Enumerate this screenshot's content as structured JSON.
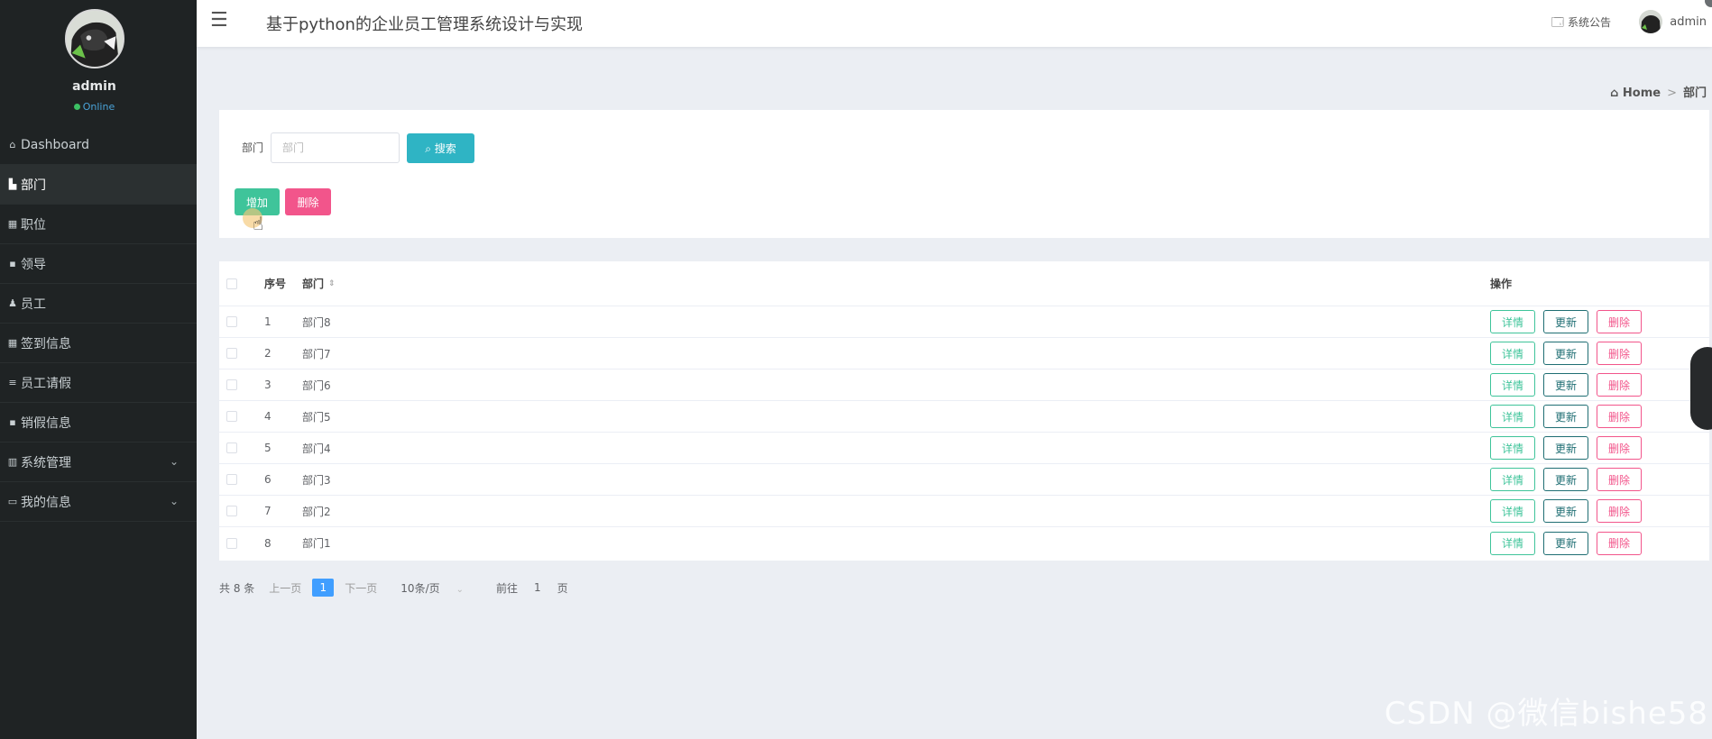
{
  "sidebar": {
    "user_name": "admin",
    "status": "Online",
    "items": [
      {
        "label": "Dashboard",
        "icon": "home-icon",
        "glyph": "⌂"
      },
      {
        "label": "部门",
        "icon": "book-icon",
        "glyph": "▙"
      },
      {
        "label": "职位",
        "icon": "grid-icon",
        "glyph": "▦"
      },
      {
        "label": "领导",
        "icon": "clipboard-icon",
        "glyph": "▪"
      },
      {
        "label": "员工",
        "icon": "user-icon",
        "glyph": "♟"
      },
      {
        "label": "签到信息",
        "icon": "grid-icon",
        "glyph": "▦"
      },
      {
        "label": "员工请假",
        "icon": "list-icon",
        "glyph": "≡"
      },
      {
        "label": "销假信息",
        "icon": "clipboard-icon",
        "glyph": "▪"
      },
      {
        "label": "系统管理",
        "icon": "chart-icon",
        "glyph": "▥"
      },
      {
        "label": "我的信息",
        "icon": "card-icon",
        "glyph": "▭"
      }
    ]
  },
  "header": {
    "title": "基于python的企业员工管理系统设计与实现",
    "notice": "系统公告",
    "admin": "admin"
  },
  "breadcrumb": {
    "home": "Home",
    "sep": ">",
    "current": "部门"
  },
  "search": {
    "label": "部门",
    "placeholder": "部门",
    "button": "搜索",
    "add": "增加",
    "delete": "删除"
  },
  "table": {
    "headers": {
      "index": "序号",
      "dept": "部门",
      "ops": "操作"
    },
    "rows": [
      {
        "index": "1",
        "dept": "部门8"
      },
      {
        "index": "2",
        "dept": "部门7"
      },
      {
        "index": "3",
        "dept": "部门6"
      },
      {
        "index": "4",
        "dept": "部门5"
      },
      {
        "index": "5",
        "dept": "部门4"
      },
      {
        "index": "6",
        "dept": "部门3"
      },
      {
        "index": "7",
        "dept": "部门2"
      },
      {
        "index": "8",
        "dept": "部门1"
      }
    ],
    "actions": {
      "detail": "详情",
      "update": "更新",
      "delete": "删除"
    }
  },
  "pager": {
    "total": "共 8 条",
    "prev": "上一页",
    "current": "1",
    "next": "下一页",
    "size": "10条/页",
    "goto": "前往",
    "goto_value": "1",
    "page_suffix": "页"
  },
  "watermark": "CSDN @微信bishe58",
  "colors": {
    "sidebar_bg": "#1f2324",
    "primary": "#2fb4c4",
    "success": "#3fc49a",
    "danger": "#f2558b",
    "page_active": "#409eff"
  }
}
